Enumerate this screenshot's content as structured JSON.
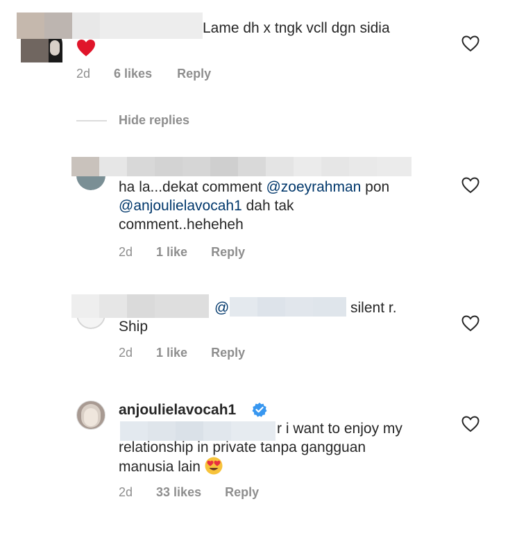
{
  "comments": [
    {
      "text": "Lame dh x tngk vcll dgn sidia",
      "time": "2d",
      "likes": "6 likes",
      "reply": "Reply"
    },
    {
      "text_line1_a": "ha la...dekat comment ",
      "mention1": "@zoeyrahman",
      "text_line1_b": " pon",
      "mention2": "@anjoulielavocah1",
      "text_line2_b": " dah tak",
      "text_line3": "comment..heheheh",
      "time": "2d",
      "likes": "1 like",
      "reply": "Reply"
    },
    {
      "at_symbol": "@",
      "text_a": "silent r.",
      "text_b": "Ship",
      "time": "2d",
      "likes": "1 like",
      "reply": "Reply"
    },
    {
      "username": "anjoulielavocah1",
      "text_line1_tail": "r i want to enjoy my",
      "text_line2": "relationship in private tanpa gangguan",
      "text_line3": "manusia lain",
      "time": "2d",
      "likes": "33 likes",
      "reply": "Reply"
    }
  ],
  "hide_replies": "Hide replies",
  "icons": {
    "heart": "heart-outline-icon",
    "heart_emoji": "red-heart-emoji",
    "verified": "verified-badge-icon",
    "heart_eyes": "heart-eyes-emoji"
  },
  "colors": {
    "mention": "#00376b",
    "meta": "#8e8e8e",
    "verified": "#3897f0",
    "heart_red": "#ed4956"
  }
}
